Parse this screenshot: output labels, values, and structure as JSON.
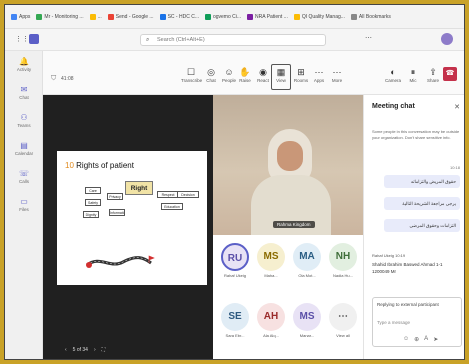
{
  "bookmarks": [
    {
      "label": "Apps",
      "color": "#4285f4"
    },
    {
      "label": "Mr - Monitoring ...",
      "color": "#34a853"
    },
    {
      "label": "...",
      "color": "#fbbc05"
    },
    {
      "label": "Send - Google ...",
      "color": "#ea4335"
    },
    {
      "label": "SC - HDC C...",
      "color": "#1a73e8"
    },
    {
      "label": "ogvemo Ci...",
      "color": "#0f9d58"
    },
    {
      "label": "NRA Patient ...",
      "color": "#7b1fa2"
    },
    {
      "label": "QI Quality Manag...",
      "color": "#fbbc05"
    },
    {
      "label": "All Bookmarks",
      "color": "#888888"
    }
  ],
  "search": {
    "placeholder": "Search (Ctrl+Alt+E)"
  },
  "timer": "41:08",
  "rail": [
    "Activity",
    "Chat",
    "Teams",
    "Calendar",
    "Calls",
    "Files"
  ],
  "toolbar": [
    {
      "icon": "☐",
      "label": "Transcribe"
    },
    {
      "icon": "◎",
      "label": "Chat"
    },
    {
      "icon": "☺",
      "label": "People"
    },
    {
      "icon": "✋",
      "label": "Raise"
    },
    {
      "icon": "◉",
      "label": "React"
    },
    {
      "icon": "▦",
      "label": "View"
    },
    {
      "icon": "⊞",
      "label": "Rooms"
    },
    {
      "icon": "⋯",
      "label": "Apps"
    },
    {
      "icon": "⋯",
      "label": "More"
    },
    {
      "icon": "◐",
      "label": "Camera"
    },
    {
      "icon": "⏸",
      "label": "Mic"
    },
    {
      "icon": "⇪",
      "label": "Share"
    }
  ],
  "slide": {
    "number": "10",
    "title": "Rights of patient",
    "center_label": "Right",
    "boxes": [
      "Care",
      "Safety",
      "Privacy",
      "Dignity",
      "Information",
      "Respect",
      "Decision",
      "Education"
    ]
  },
  "share_controls": {
    "page": "5 of 34",
    "prev": "‹",
    "next": "›"
  },
  "speaker": {
    "name": "Rahma Kingdom"
  },
  "avatars": [
    {
      "initials": "RU",
      "name": "Rahaf Ukeig",
      "bg": "#e8e2f5",
      "fg": "#5b4fa8"
    },
    {
      "initials": "MS",
      "name": "Maha...",
      "bg": "#f6efcf",
      "fg": "#8a6b00"
    },
    {
      "initials": "MA",
      "name": "Ola Mot...",
      "bg": "#e0edf6",
      "fg": "#2b5e84"
    },
    {
      "initials": "NH",
      "name": "Nadia Hu...",
      "bg": "#e2efe0",
      "fg": "#3f6e3a"
    },
    {
      "initials": "SE",
      "name": "Sara Ebr...",
      "bg": "#e0ecf5",
      "fg": "#2e5a80"
    },
    {
      "initials": "AH",
      "name": "Ala Alq...",
      "bg": "#f7e1e1",
      "fg": "#9a2b2b"
    },
    {
      "initials": "MS",
      "name": "Manar...",
      "bg": "#e8e2f5",
      "fg": "#5b4fa8"
    },
    {
      "initials": "⋯",
      "name": "View all",
      "bg": "#f0f0f0",
      "fg": "#555555"
    }
  ],
  "chat": {
    "title": "Meeting chat",
    "note": "Some people in this conversation may be outside your organization. Don't share sensitive info.",
    "time": "10:18",
    "bubbles": [
      "حقوق المريض والتزاماته",
      "يرجى مراجعة الشريحة التالية",
      "التزامات وحقوق المرضى"
    ],
    "meta": "Rahaf Ukeig 10:19",
    "message": "Shahid Ibrahim Baswed Ahmad 1-1 1200049 Mr",
    "reply_to": "Replying to external participant",
    "placeholder": "Type a message"
  }
}
